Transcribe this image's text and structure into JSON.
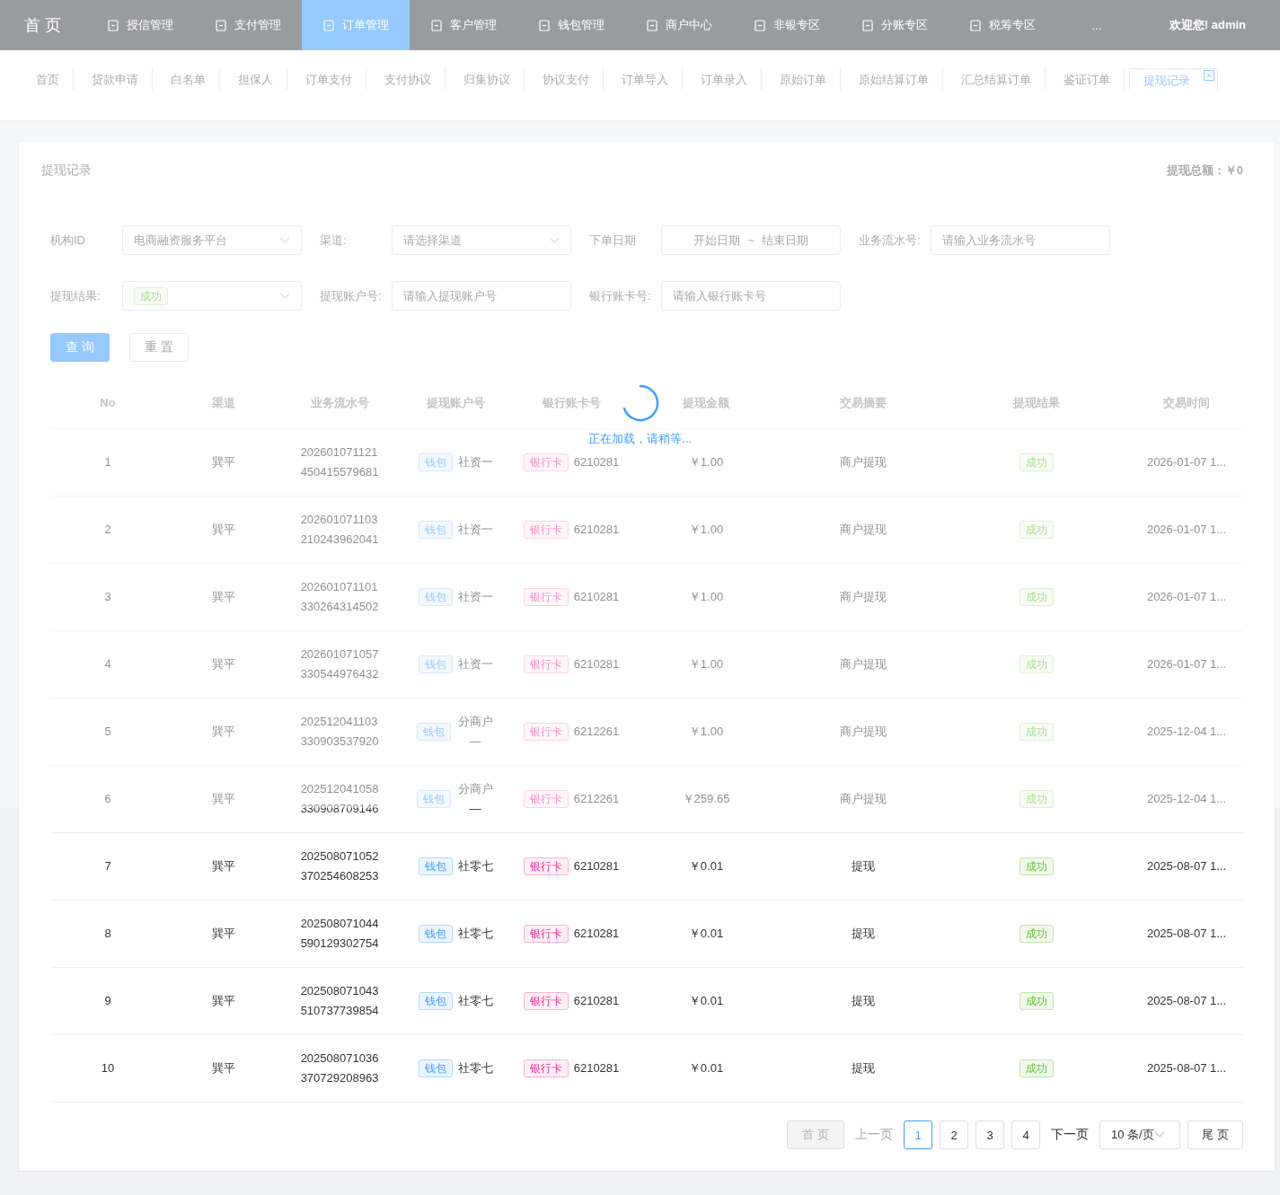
{
  "nav": {
    "logo": "首 页",
    "items": [
      {
        "label": "授信管理",
        "selected": false
      },
      {
        "label": "支付管理",
        "selected": false
      },
      {
        "label": "订单管理",
        "selected": true
      },
      {
        "label": "客户管理",
        "selected": false
      },
      {
        "label": "钱包管理",
        "selected": false
      },
      {
        "label": "商户中心",
        "selected": false
      },
      {
        "label": "非银专区",
        "selected": false
      },
      {
        "label": "分账专区",
        "selected": false
      },
      {
        "label": "税筹专区",
        "selected": false
      }
    ],
    "more": "...",
    "user": "欢迎您! admin"
  },
  "tags": [
    {
      "label": "首页",
      "selected": false
    },
    {
      "label": "贷款申请",
      "selected": false
    },
    {
      "label": "白名单",
      "selected": false
    },
    {
      "label": "担保人",
      "selected": false
    },
    {
      "label": "订单支付",
      "selected": false
    },
    {
      "label": "支付协议",
      "selected": false
    },
    {
      "label": "归集协议",
      "selected": false
    },
    {
      "label": "协议支付",
      "selected": false
    },
    {
      "label": "订单导入",
      "selected": false
    },
    {
      "label": "订单录入",
      "selected": false
    },
    {
      "label": "原始订单",
      "selected": false
    },
    {
      "label": "原始结算订单",
      "selected": false
    },
    {
      "label": "汇总结算订单",
      "selected": false
    },
    {
      "label": "鉴证订单",
      "selected": false
    },
    {
      "label": "提现记录",
      "selected": true
    }
  ],
  "card": {
    "title": "提现记录",
    "total": "提现总额：￥0"
  },
  "filters": [
    {
      "kind": "select",
      "label": "机构ID",
      "value": "电商融资服务平台"
    },
    {
      "kind": "select",
      "label": "渠道:",
      "placeholder": "请选择渠道"
    },
    {
      "kind": "date",
      "label": "下单日期",
      "start_placeholder": "开始日期",
      "separator": "~",
      "end_placeholder": "结束日期"
    },
    {
      "kind": "input",
      "label": "业务流水号:",
      "placeholder": "请输入业务流水号"
    },
    {
      "kind": "tagselect",
      "label": "提现结果:",
      "tag": "成功"
    },
    {
      "kind": "input",
      "label": "提现账户号:",
      "placeholder": "请输入提现账户号"
    },
    {
      "kind": "input",
      "label": "银行账卡号:",
      "placeholder": "请输入银行账卡号"
    }
  ],
  "buttons": {
    "search": "查 询",
    "reset": "重 置"
  },
  "table": {
    "columns": [
      "No",
      "渠道",
      "业务流水号",
      "提现账户号",
      "银行账卡号",
      "提现金额",
      "交易摘要",
      "提现结果",
      "交易时间"
    ],
    "rows": [
      {
        "no": "1",
        "channel": "巽平",
        "serial": "202601071121450415579681",
        "wallet_tag": "钱包",
        "account": "社资一",
        "bank_tag": "银行卡",
        "card": "6210281",
        "amount": "￥1.00",
        "summary": "商户提现",
        "result": "成功",
        "time": "2026-01-07 1..."
      },
      {
        "no": "2",
        "channel": "巽平",
        "serial": "202601071103210243962041",
        "wallet_tag": "钱包",
        "account": "社资一",
        "bank_tag": "银行卡",
        "card": "6210281",
        "amount": "￥1.00",
        "summary": "商户提现",
        "result": "成功",
        "time": "2026-01-07 1..."
      },
      {
        "no": "3",
        "channel": "巽平",
        "serial": "202601071101330264314502",
        "wallet_tag": "钱包",
        "account": "社资一",
        "bank_tag": "银行卡",
        "card": "6210281",
        "amount": "￥1.00",
        "summary": "商户提现",
        "result": "成功",
        "time": "2026-01-07 1..."
      },
      {
        "no": "4",
        "channel": "巽平",
        "serial": "202601071057330544976432",
        "wallet_tag": "钱包",
        "account": "社资一",
        "bank_tag": "银行卡",
        "card": "6210281",
        "amount": "￥1.00",
        "summary": "商户提现",
        "result": "成功",
        "time": "2026-01-07 1..."
      },
      {
        "no": "5",
        "channel": "巽平",
        "serial": "202512041103330903537920",
        "wallet_tag": "钱包",
        "account": "分商户—",
        "bank_tag": "银行卡",
        "card": "6212261",
        "amount": "￥1.00",
        "summary": "商户提现",
        "result": "成功",
        "time": "2025-12-04 1..."
      },
      {
        "no": "6",
        "channel": "巽平",
        "serial": "202512041058330908709146",
        "wallet_tag": "钱包",
        "account": "分商户—",
        "bank_tag": "银行卡",
        "card": "6212261",
        "amount": "￥259.65",
        "summary": "商户提现",
        "result": "成功",
        "time": "2025-12-04 1..."
      },
      {
        "no": "7",
        "channel": "巽平",
        "serial": "202508071052370254608253",
        "wallet_tag": "钱包",
        "account": "社零七",
        "bank_tag": "银行卡",
        "card": "6210281",
        "amount": "￥0.01",
        "summary": "提现",
        "result": "成功",
        "time": "2025-08-07 1..."
      },
      {
        "no": "8",
        "channel": "巽平",
        "serial": "202508071044590129302754",
        "wallet_tag": "钱包",
        "account": "社零七",
        "bank_tag": "银行卡",
        "card": "6210281",
        "amount": "￥0.01",
        "summary": "提现",
        "result": "成功",
        "time": "2025-08-07 1..."
      },
      {
        "no": "9",
        "channel": "巽平",
        "serial": "202508071043510737739854",
        "wallet_tag": "钱包",
        "account": "社零七",
        "bank_tag": "银行卡",
        "card": "6210281",
        "amount": "￥0.01",
        "summary": "提现",
        "result": "成功",
        "time": "2025-08-07 1..."
      },
      {
        "no": "10",
        "channel": "巽平",
        "serial": "202508071036370729208963",
        "wallet_tag": "钱包",
        "account": "社零七",
        "bank_tag": "银行卡",
        "card": "6210281",
        "amount": "￥0.01",
        "summary": "提现",
        "result": "成功",
        "time": "2025-08-07 1..."
      }
    ]
  },
  "pagination": {
    "first": {
      "label": "首 页",
      "disabled": true
    },
    "prev": {
      "label": "上一页",
      "disabled": true
    },
    "pages": [
      {
        "label": "1",
        "selected": true
      },
      {
        "label": "2",
        "selected": false
      },
      {
        "label": "3",
        "selected": false
      },
      {
        "label": "4",
        "selected": false
      }
    ],
    "next": {
      "label": "下一页",
      "disabled": false
    },
    "page_size": "10 条/页",
    "last": {
      "label": "尾 页",
      "disabled": false
    }
  },
  "loading": {
    "text": "正在加载，请稍等..."
  }
}
